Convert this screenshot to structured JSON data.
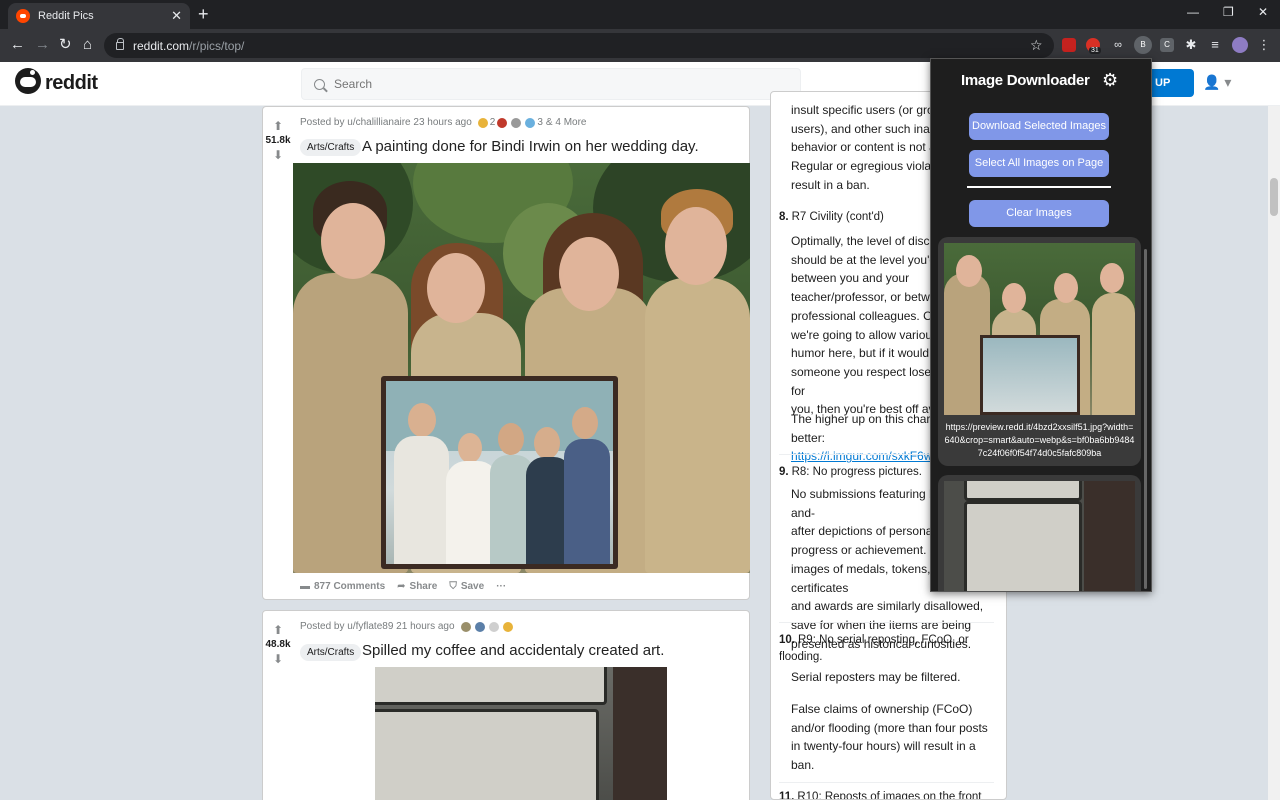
{
  "browser": {
    "tab_title": "Reddit Pics",
    "tab_close": "✕",
    "new_tab": "+",
    "url_host": "reddit.com",
    "url_path": "/r/pics/top/",
    "ext_calendar_badge": "31",
    "ext_b": "B",
    "ext_c": "C"
  },
  "reddit": {
    "logo_text": "reddit",
    "search_placeholder": "Search",
    "signup_label": "UP"
  },
  "posts": [
    {
      "score": "51.8k",
      "posted_by": "Posted by u/chalillianaire 23 hours ago",
      "award_count_1": "2",
      "award_count_2": "3",
      "more_awards": "& 4 More",
      "flair": "Arts/Crafts",
      "title": "A painting done for Bindi Irwin on her wedding day.",
      "comments": "877 Comments",
      "share": "Share",
      "save": "Save",
      "more": "···"
    },
    {
      "score": "48.8k",
      "posted_by": "Posted by u/fyflate89 21 hours ago",
      "flair": "Arts/Crafts",
      "title": "Spilled my coffee and accidentaly created art."
    }
  ],
  "sidebar": {
    "intro_lines": [
      "insult specific users (or groups of",
      "users), and other such inappropriate",
      "behavior or content is not allowed.",
      "Regular or egregious violations will",
      "result in a ban."
    ],
    "rules": [
      {
        "num": "8.",
        "title": "R7 Civility (cont'd)",
        "body": [
          "Optimally, the level of discourse",
          "should be at the level you'd expect",
          "between you and your",
          "teacher/professor, or between",
          "professional colleagues. Obviously",
          "we're going to allow various types of",
          "humor here, but if it would make",
          "someone you respect lose respect for",
          "you, then you're best off avoiding it."
        ],
        "body2": "The higher up on this chart, the better:",
        "link": "https://i.imgur.com/sxkF6wQ.jpg"
      },
      {
        "num": "9.",
        "title": "R8: No progress pictures.",
        "body": [
          "No submissions featuring before-and-",
          "after depictions of personal health",
          "progress or achievement. Still",
          "images of medals, tokens, certificates",
          "and awards are similarly disallowed,",
          "save for when the items are being",
          "presented as historical curiosities."
        ]
      },
      {
        "num": "10.",
        "title": "R9: No serial reposting, FCoO, or flooding.",
        "body": [
          "Serial reposters may be filtered."
        ],
        "body2_lines": [
          "False claims of ownership (FCoO)",
          "and/or flooding (more than four posts",
          "in twenty-four hours) will result in a",
          "ban."
        ]
      },
      {
        "num": "11.",
        "title": "R10: Reposts of images on the front"
      }
    ]
  },
  "popup": {
    "title": "Image Downloader",
    "download_btn": "Download Selected Images",
    "select_all_btn": "Select All Images on Page",
    "clear_btn": "Clear Images",
    "image_url": "https://preview.redd.it/4bzd2xxsilf51.jpg?width=640&crop=smart&auto=webp&s=bf0ba6bb94847c24f06f0f54f74d0c5fafc809ba"
  },
  "colors": {
    "reddit_orange": "#ff4500",
    "reddit_blue": "#0079d3",
    "popup_button": "#8097e8",
    "popup_bg": "#1e1e1e"
  }
}
